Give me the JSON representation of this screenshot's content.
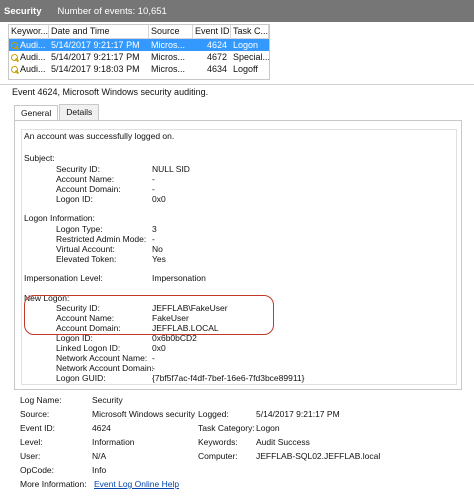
{
  "titlebar": {
    "title": "Security",
    "count": "Number of events: 10,651"
  },
  "columns": [
    "Keywor...",
    "Date and Time",
    "Source",
    "Event ID",
    "Task C..."
  ],
  "rows": [
    {
      "keyword": "Audi...",
      "date": "5/14/2017 9:21:17 PM",
      "source": "Micros...",
      "event_id": "4624",
      "task": "Logon"
    },
    {
      "keyword": "Audi...",
      "date": "5/14/2017 9:21:17 PM",
      "source": "Micros...",
      "event_id": "4672",
      "task": "Special..."
    },
    {
      "keyword": "Audi...",
      "date": "5/14/2017 9:18:03 PM",
      "source": "Micros...",
      "event_id": "4634",
      "task": "Logoff"
    }
  ],
  "event_header": "Event 4624, Microsoft Windows security auditing.",
  "tabs": {
    "general": "General",
    "details": "Details"
  },
  "desc": {
    "intro": "An account was successfully logged on.",
    "subject_h": "Subject:",
    "security_id_l": "Security ID:",
    "security_id_v": "NULL SID",
    "account_name_l": "Account Name:",
    "account_name_v": "-",
    "account_domain_l": "Account Domain:",
    "account_domain_v": "-",
    "logon_id_l": "Logon ID:",
    "logon_id_v": "0x0",
    "logon_info_h": "Logon Information:",
    "logon_type_l": "Logon Type:",
    "logon_type_v": "3",
    "restricted_l": "Restricted Admin Mode:",
    "restricted_v": "-",
    "virtual_l": "Virtual Account:",
    "virtual_v": "No",
    "elevated_l": "Elevated Token:",
    "elevated_v": "Yes",
    "imp_l": "Impersonation Level:",
    "imp_v": "Impersonation",
    "new_logon_h": "New Logon:",
    "n_security_id_l": "Security ID:",
    "n_security_id_v": "JEFFLAB\\FakeUser",
    "n_account_name_l": "Account Name:",
    "n_account_name_v": "FakeUser",
    "n_account_domain_l": "Account Domain:",
    "n_account_domain_v": "JEFFLAB.LOCAL",
    "n_logon_id_l": "Logon ID:",
    "n_logon_id_v": "0x6b0bCD2",
    "linked_l": "Linked Logon ID:",
    "linked_v": "0x0",
    "net_name_l": "Network Account Name:",
    "net_name_v": "-",
    "net_domain_l": "Network Account Domain:",
    "net_domain_v": "-",
    "guid_l": "Logon GUID:",
    "guid_v": "{7bf5f7ac-f4df-7bef-16e6-7fd3bce89911}"
  },
  "details": {
    "log_name_l": "Log Name:",
    "log_name_v": "Security",
    "source_l": "Source:",
    "source_v": "Microsoft Windows security",
    "logged_l": "Logged:",
    "logged_v": "5/14/2017 9:21:17 PM",
    "event_id_l": "Event ID:",
    "event_id_v": "4624",
    "task_l": "Task Category:",
    "task_v": "Logon",
    "level_l": "Level:",
    "level_v": "Information",
    "keywords_l": "Keywords:",
    "keywords_v": "Audit Success",
    "user_l": "User:",
    "user_v": "N/A",
    "computer_l": "Computer:",
    "computer_v": "JEFFLAB-SQL02.JEFFLAB.local",
    "opcode_l": "OpCode:",
    "opcode_v": "Info",
    "more_l": "More Information:",
    "more_v": "Event Log Online Help"
  }
}
